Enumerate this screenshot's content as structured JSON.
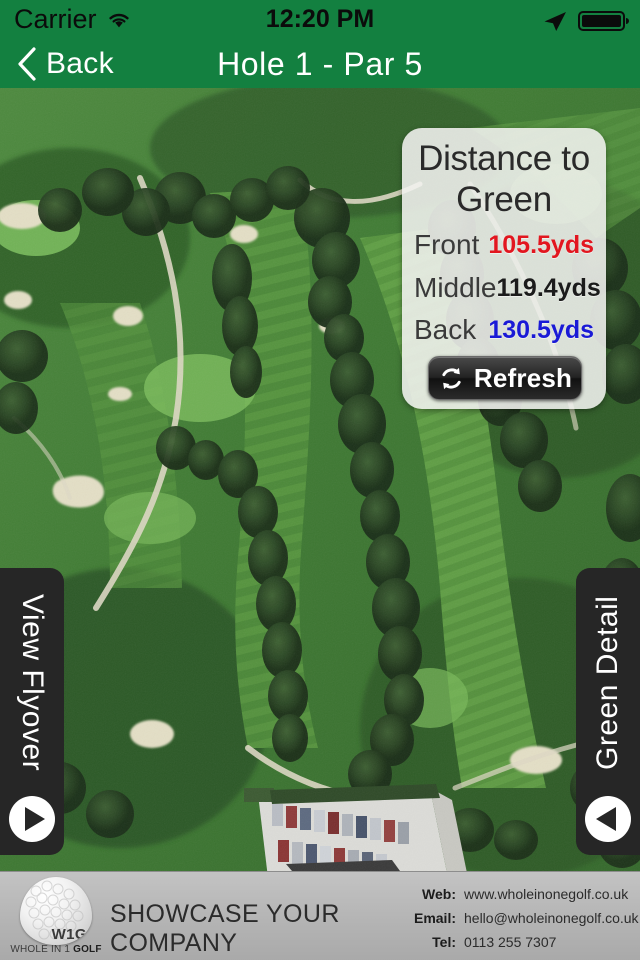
{
  "status_bar": {
    "carrier": "Carrier",
    "time": "12:20 PM",
    "wifi_icon": "wifi-icon",
    "location_icon": "location-arrow-icon",
    "battery_icon": "battery-full-icon"
  },
  "nav_bar": {
    "back_label": "Back",
    "back_icon": "chevron-left-icon",
    "title": "Hole 1 - Par 5",
    "background_color": "#138040"
  },
  "distance_panel": {
    "title": "Distance to Green",
    "rows": [
      {
        "label": "Front",
        "value": "105.5yds",
        "color": "#e2161f"
      },
      {
        "label": "Middle",
        "value": "119.4yds",
        "color": "#1b1b1b"
      },
      {
        "label": "Back",
        "value": "130.5yds",
        "color": "#1a1ad6"
      }
    ],
    "refresh_label": "Refresh",
    "refresh_icon": "refresh-circular-arrows-icon"
  },
  "side_tabs": {
    "left": {
      "label": "View Flyover",
      "icon": "play-triangle-right-icon"
    },
    "right": {
      "label": "Green Detail",
      "icon": "play-triangle-left-icon"
    }
  },
  "footer": {
    "logo": {
      "ball_text": "W1G",
      "tagline_prefix": "WHOLE IN 1 ",
      "tagline_bold": "GOLF",
      "icon": "golf-ball-logo"
    },
    "headline": "SHOWCASE YOUR COMPANY",
    "contacts": [
      {
        "label": "Web:",
        "value": "www.wholeinonegolf.co.uk"
      },
      {
        "label": "Email:",
        "value": "hello@wholeinonegolf.co.uk"
      },
      {
        "label": "Tel:",
        "value": "0113 255 7307"
      }
    ]
  }
}
